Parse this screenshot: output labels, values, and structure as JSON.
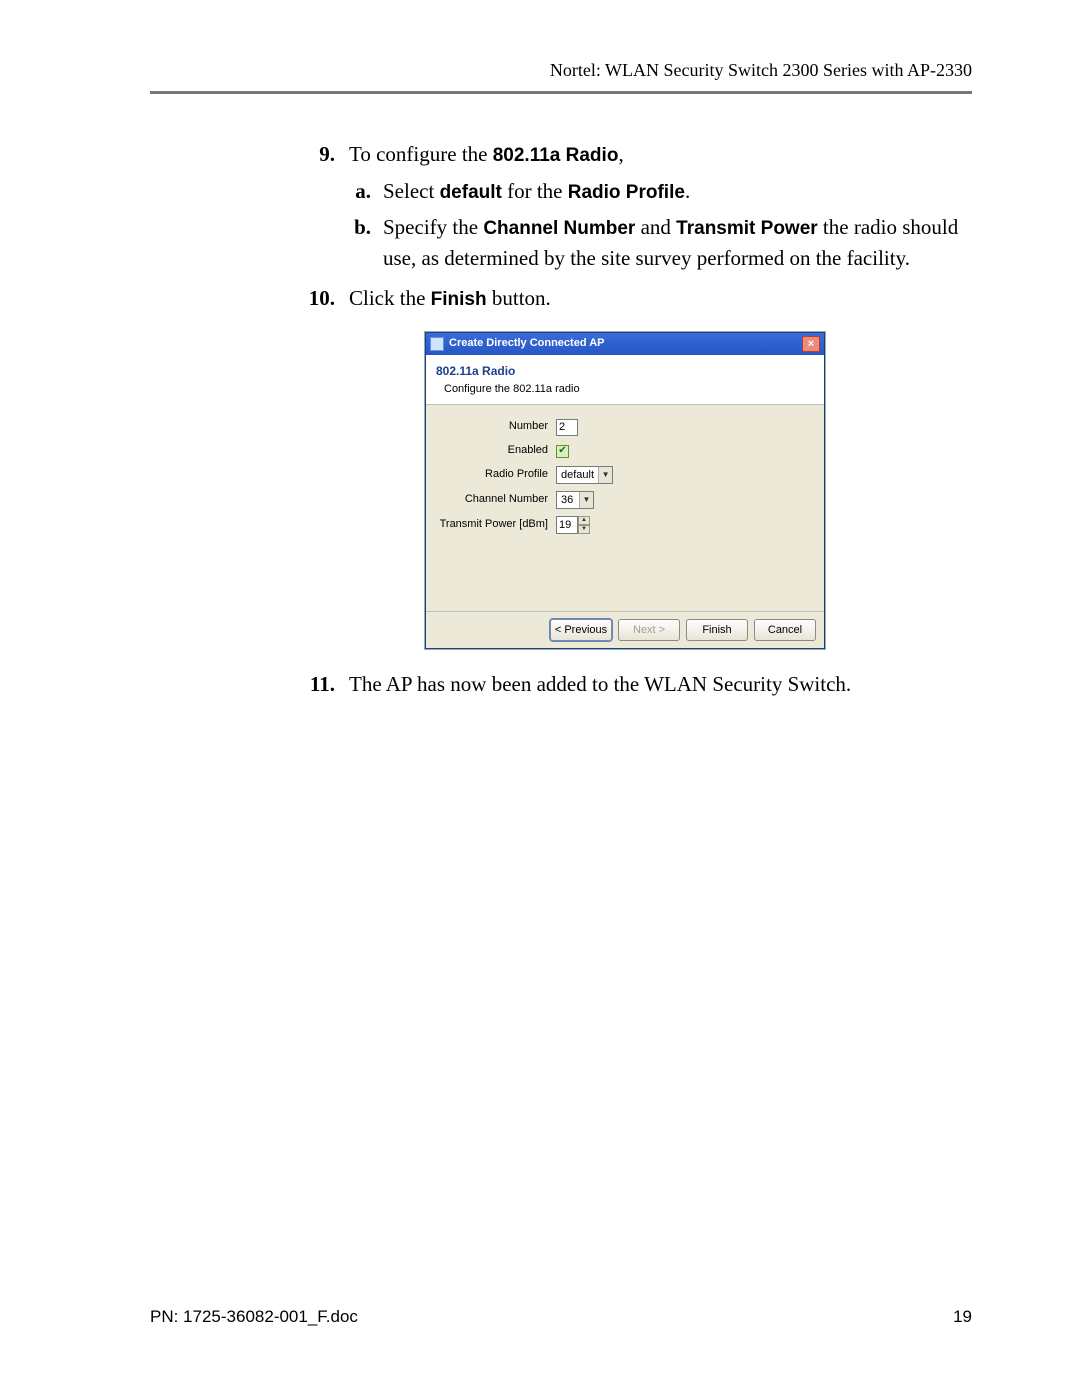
{
  "header": {
    "title": "Nortel: WLAN Security Switch 2300 Series with AP-2330"
  },
  "steps": {
    "s9": {
      "num": "9.",
      "prefix": "To configure the ",
      "bold": "802.11a Radio",
      "suffix": ",",
      "a": {
        "num": "a.",
        "t1": "Select ",
        "b1": "default",
        "t2": " for the ",
        "b2": "Radio Profile",
        "t3": "."
      },
      "b": {
        "num": "b.",
        "t1": "Specify the ",
        "b1": "Channel Number",
        "t2": " and ",
        "b2": "Transmit Power",
        "t3": " the radio should use, as determined by the site survey performed on the facility."
      }
    },
    "s10": {
      "num": "10.",
      "t1": "Click the ",
      "b1": "Finish",
      "t2": " button."
    },
    "s11": {
      "num": "11.",
      "text": "The AP has now been added to the WLAN Security Switch."
    }
  },
  "dialog": {
    "title": "Create Directly Connected AP",
    "close": "×",
    "heading": "802.11a Radio",
    "subheading": "Configure the 802.11a radio",
    "fields": {
      "number": {
        "label": "Number",
        "value": "2"
      },
      "enabled": {
        "label": "Enabled",
        "checked": "✔"
      },
      "radio_profile": {
        "label": "Radio Profile",
        "value": "default"
      },
      "channel_number": {
        "label": "Channel Number",
        "value": "36"
      },
      "tx_power": {
        "label": "Transmit Power [dBm]",
        "value": "19"
      }
    },
    "buttons": {
      "previous": "< Previous",
      "next": "Next >",
      "finish": "Finish",
      "cancel": "Cancel"
    }
  },
  "footer": {
    "pn": "PN: 1725-36082-001_F.doc",
    "page": "19"
  }
}
